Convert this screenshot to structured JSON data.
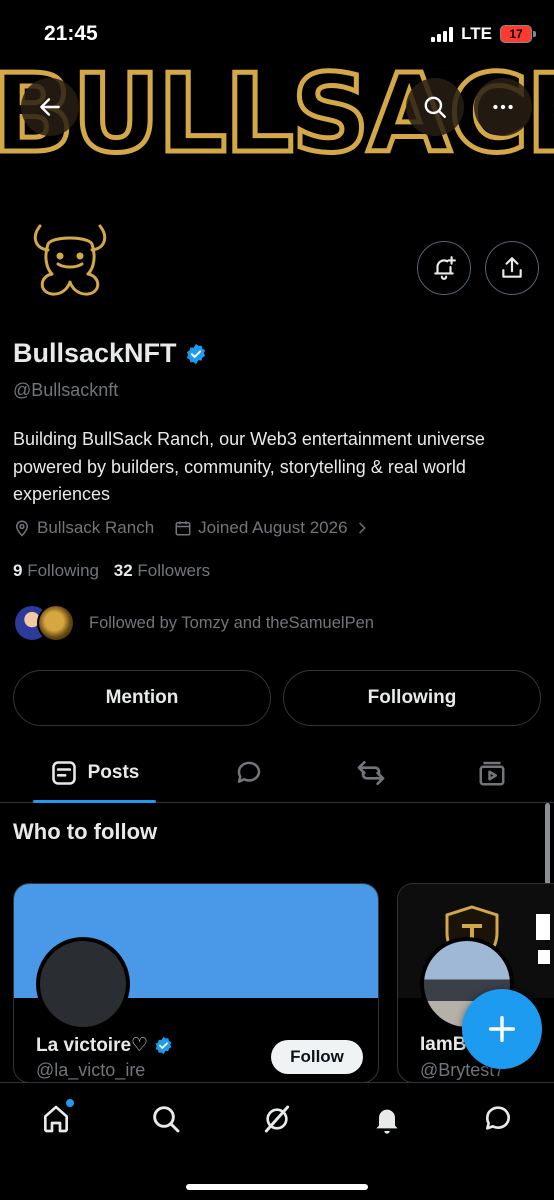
{
  "status_bar": {
    "time": "21:45",
    "network": "LTE",
    "battery": "17"
  },
  "banner": {
    "text": "BULLSACK"
  },
  "profile": {
    "name": "BullsackNFT",
    "handle": "@Bullsacknft",
    "bio": "Building BullSack Ranch, our Web3 entertainment universe powered by builders, community, storytelling & real world experiences",
    "location": "Bullsack Ranch",
    "joined": "Joined August 2026",
    "following_count": "9",
    "following_label": "Following",
    "followers_count": "32",
    "followers_label": "Followers",
    "followed_by": "Followed by Tomzy and theSamuelPen"
  },
  "actions": {
    "mention": "Mention",
    "following": "Following"
  },
  "tabs": {
    "posts": "Posts"
  },
  "who_to_follow": {
    "title": "Who to follow",
    "cards": [
      {
        "name": "La victoire♡",
        "handle": "@la_victo_ire",
        "follow": "Follow",
        "banner_color": "#4a99e9"
      },
      {
        "name": "IamB",
        "handle": "@Brytest7"
      }
    ]
  },
  "colors": {
    "accent": "#1d9bf0",
    "gold": "#d4a846",
    "verified": "#1d9bf0"
  }
}
